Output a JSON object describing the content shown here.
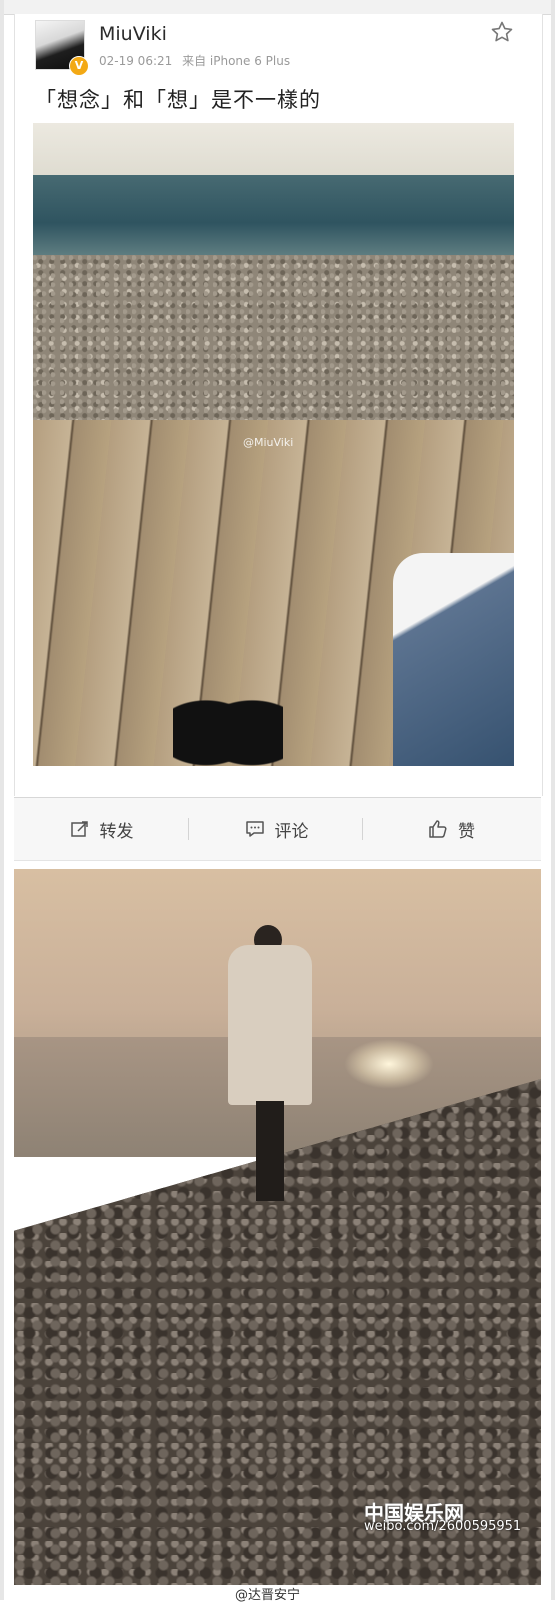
{
  "post": {
    "username": "MiuViki",
    "time": "02-19 06:21",
    "source": "来自 iPhone 6 Plus",
    "verified_badge": "V",
    "text": "「想念」和「想」是不一樣的",
    "photo_watermark": "@MiuViki"
  },
  "actions": {
    "repost": "转发",
    "comment": "评论",
    "like": "赞"
  },
  "second_photo": {
    "logo": "中国娱乐网",
    "watermark": "weibo.com/2600595951",
    "credit": "@达晋安宁"
  },
  "icons": [
    "star-icon",
    "repost-icon",
    "comment-icon",
    "like-icon"
  ],
  "colors": {
    "badge": "#f3a915",
    "action_bar": "#f7f7f7"
  }
}
